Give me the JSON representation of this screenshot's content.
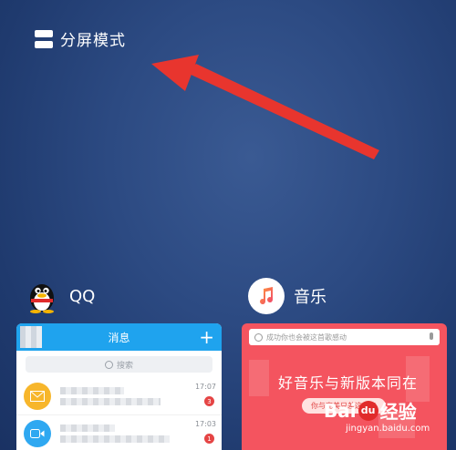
{
  "split_mode": {
    "label": "分屏模式"
  },
  "apps": [
    {
      "name": "QQ"
    },
    {
      "name": "音乐"
    }
  ],
  "qq_window": {
    "header_title": "消息",
    "plus_label": "+",
    "search_placeholder": "搜索",
    "messages": [
      {
        "icon": "mail-icon",
        "time": "17:07",
        "badge": "3"
      },
      {
        "icon": "video-call-icon",
        "time": "17:03",
        "badge": "1"
      }
    ]
  },
  "music_window": {
    "search_placeholder": "成功你也会被这首歌感动",
    "banner_title": "好音乐与新版本同在",
    "banner_button": "你与完美只差这一步"
  },
  "watermark": {
    "main_left": "Bai",
    "paw": "du",
    "main_right": "经验",
    "sub": "jingyan.baidu.com"
  },
  "colors": {
    "background": "#2c4a82",
    "qq_header": "#1fa3ee",
    "music_banner": "#f4545f",
    "arrow": "#e8352e"
  }
}
